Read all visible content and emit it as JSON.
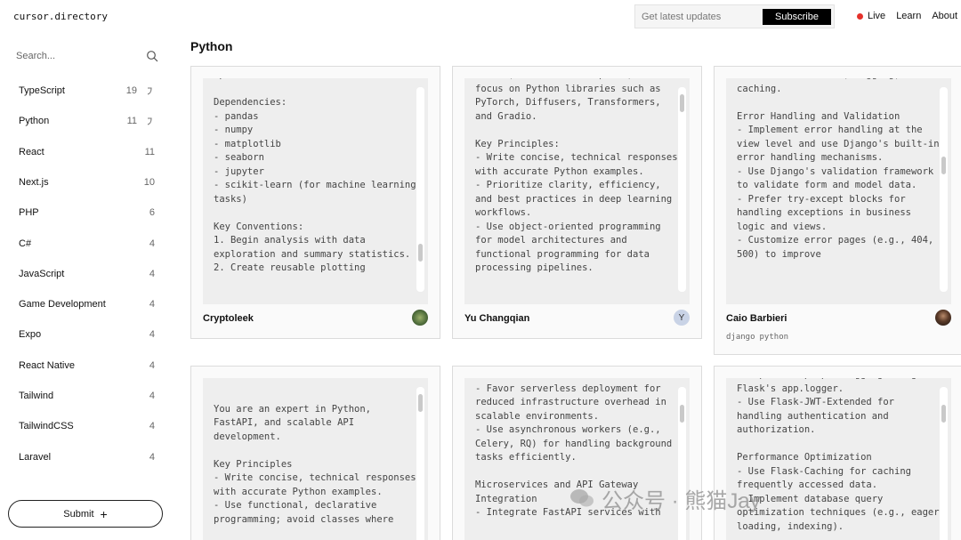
{
  "header": {
    "brand": "cursor.directory",
    "subscribe_placeholder": "Get latest updates",
    "subscribe_button": "Subscribe",
    "nav": [
      "Live",
      "Learn",
      "About"
    ]
  },
  "sidebar": {
    "search_placeholder": "Search...",
    "categories": [
      {
        "label": "TypeScript",
        "count": "19",
        "trend": true
      },
      {
        "label": "Python",
        "count": "11",
        "trend": true
      },
      {
        "label": "React",
        "count": "11",
        "trend": false
      },
      {
        "label": "Next.js",
        "count": "10",
        "trend": false
      },
      {
        "label": "PHP",
        "count": "6",
        "trend": false
      },
      {
        "label": "C#",
        "count": "4",
        "trend": false
      },
      {
        "label": "JavaScript",
        "count": "4",
        "trend": false
      },
      {
        "label": "Game Development",
        "count": "4",
        "trend": false
      },
      {
        "label": "Expo",
        "count": "4",
        "trend": false
      },
      {
        "label": "React Native",
        "count": "4",
        "trend": false
      },
      {
        "label": "Tailwind",
        "count": "4",
        "trend": false
      },
      {
        "label": "TailwindCSS",
        "count": "4",
        "trend": false
      },
      {
        "label": "Laravel",
        "count": "4",
        "trend": false
      }
    ],
    "submit_label": "Submit",
    "submit_icon": "plus-icon"
  },
  "main": {
    "title": "Python",
    "cards": [
      {
        "author": "Cryptoleek",
        "avatar_text": "",
        "tags": [],
        "lines": [
          "optimize bottlenecks.",
          "",
          "Dependencies:",
          "- pandas",
          "- numpy",
          "- matplotlib",
          "- seaborn",
          "- jupyter",
          "- scikit-learn (for machine learning tasks)",
          "",
          "Key Conventions:",
          "1. Begin analysis with data exploration and summary statistics.",
          "2. Create reusable plotting"
        ]
      },
      {
        "author": "Yu Changqian",
        "avatar_text": "Y",
        "tags": [],
        "lines": [
          "models, and LLM development, with a focus on Python libraries such as PyTorch, Diffusers, Transformers, and Gradio.",
          "",
          "Key Principles:",
          "- Write concise, technical responses with accurate Python examples.",
          "- Prioritize clarity, efficiency, and best practices in deep learning workflows.",
          "- Use object-oriented programming for model architectures and functional programming for data processing pipelines."
        ]
      },
      {
        "author": "Caio Barbieri",
        "avatar_text": "",
        "tags": [
          "django",
          "python"
        ],
        "lines": [
          "like authentication, logging, and caching.",
          "",
          "Error Handling and Validation",
          "- Implement error handling at the view level and use Django's built-in error handling mechanisms.",
          "- Use Django's validation framework to validate form and model data.",
          "- Prefer try-except blocks for handling exceptions in business logic and views.",
          "- Customize error pages (e.g., 404, 500) to improve"
        ]
      },
      {
        "author": "",
        "avatar_text": "",
        "tags": [],
        "lines": [
          "",
          "You are an expert in Python, FastAPI, and scalable API development.",
          "",
          "Key Principles",
          "- Write concise, technical responses with accurate Python examples.",
          "- Use functional, declarative programming; avoid classes where"
        ]
      },
      {
        "author": "",
        "avatar_text": "",
        "tags": [],
        "lines": [
          "communication.",
          "- Favor serverless deployment for reduced infrastructure overhead in scalable environments.",
          "- Use asynchronous workers (e.g., Celery, RQ) for handling background tasks efficiently.",
          "",
          "Microservices and API Gateway Integration",
          "- Integrate FastAPI services with"
        ]
      },
      {
        "author": "",
        "avatar_text": "",
        "tags": [],
        "lines": [
          "- Implement proper logging using Flask's app.logger.",
          "- Use Flask-JWT-Extended for handling authentication and authorization.",
          "",
          "Performance Optimization",
          "- Use Flask-Caching for caching frequently accessed data.",
          "- Implement database query optimization techniques (e.g., eager loading, indexing)."
        ]
      }
    ]
  },
  "watermark": "公众号 · 熊猫Jay"
}
